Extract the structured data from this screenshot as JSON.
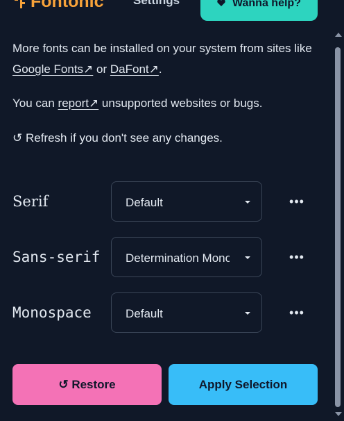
{
  "header": {
    "logo_text": "Fontonic",
    "settings_label": "Settings",
    "help_label": "Wanna help?"
  },
  "info": {
    "line1_prefix": "More fonts can be installed on your system from sites like",
    "link_google": "Google Fonts↗",
    "or_text": " or ",
    "link_dafont": "DaFont↗",
    "period": ".",
    "report_prefix": "You can ",
    "report_link": "report↗",
    "report_suffix": " unsupported websites or bugs.",
    "refresh_text": "↺ Refresh if you don't see any changes."
  },
  "fonts": {
    "serif": {
      "label": "Serif",
      "value": "Default"
    },
    "sans": {
      "label": "Sans-serif",
      "value": "Determination Mono"
    },
    "mono": {
      "label": "Monospace",
      "value": "Default"
    },
    "more_glyph": "•••"
  },
  "actions": {
    "restore_label": "↺ Restore",
    "apply_label": "Apply Selection"
  },
  "colors": {
    "background": "#101828",
    "logo": "#f7a23a",
    "help_button": "#2dd4bf",
    "restore_button": "#f472b6",
    "apply_button": "#38bdf8"
  }
}
